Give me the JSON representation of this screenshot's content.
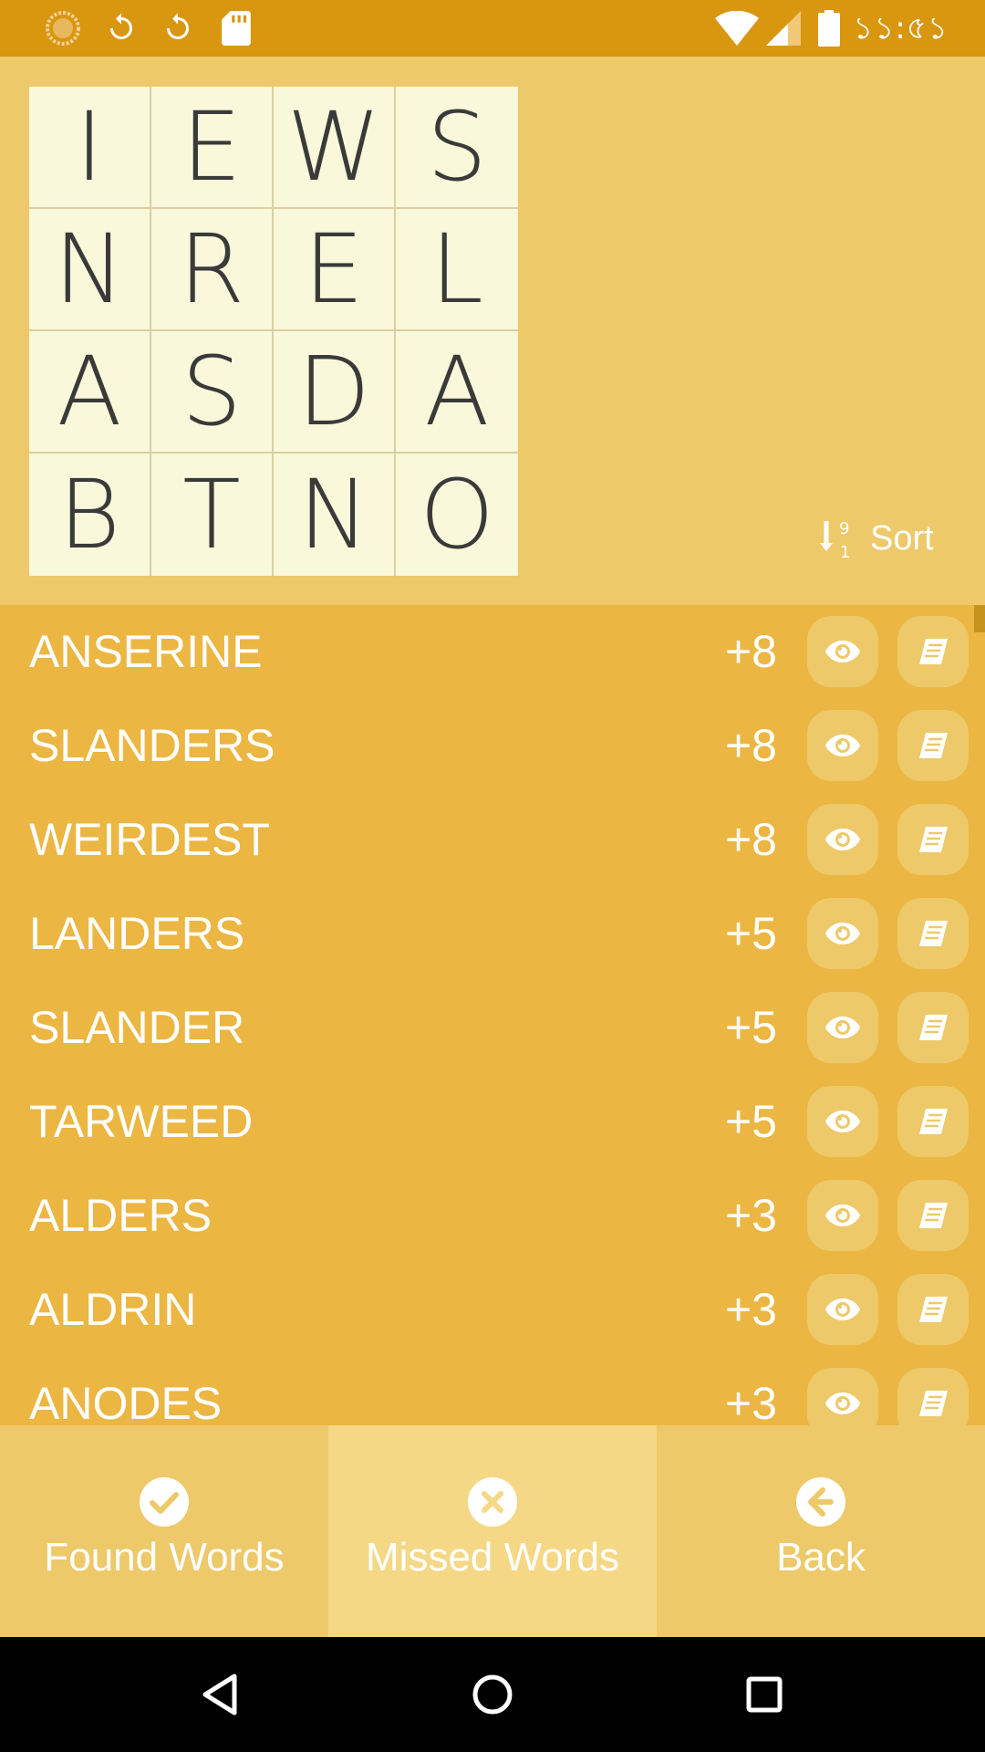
{
  "status_bar": {
    "time": "১১:৫১",
    "icons": [
      "loading-icon",
      "sync-icon",
      "sync-icon",
      "sd-card-icon",
      "wifi-icon",
      "cell-signal-icon",
      "battery-icon"
    ]
  },
  "board": {
    "letters": [
      "I",
      "E",
      "W",
      "S",
      "N",
      "R",
      "E",
      "L",
      "A",
      "S",
      "D",
      "A",
      "B",
      "T",
      "N",
      "O"
    ]
  },
  "sort": {
    "label": "Sort"
  },
  "words": [
    {
      "word": "ANSERINE",
      "score": "+8"
    },
    {
      "word": "SLANDERS",
      "score": "+8"
    },
    {
      "word": "WEIRDEST",
      "score": "+8"
    },
    {
      "word": "LANDERS",
      "score": "+5"
    },
    {
      "word": "SLANDER",
      "score": "+5"
    },
    {
      "word": "TARWEED",
      "score": "+5"
    },
    {
      "word": "ALDERS",
      "score": "+3"
    },
    {
      "word": "ALDRIN",
      "score": "+3"
    },
    {
      "word": "ANODES",
      "score": "+3"
    }
  ],
  "tabs": {
    "found": "Found Words",
    "missed": "Missed Words",
    "back": "Back",
    "active": "missed"
  },
  "colors": {
    "status_bar": "#D9960F",
    "panel": "#EDC96A",
    "list": "#EBB642",
    "tab_active": "#F5D886",
    "tile": "#F9F8DA"
  }
}
